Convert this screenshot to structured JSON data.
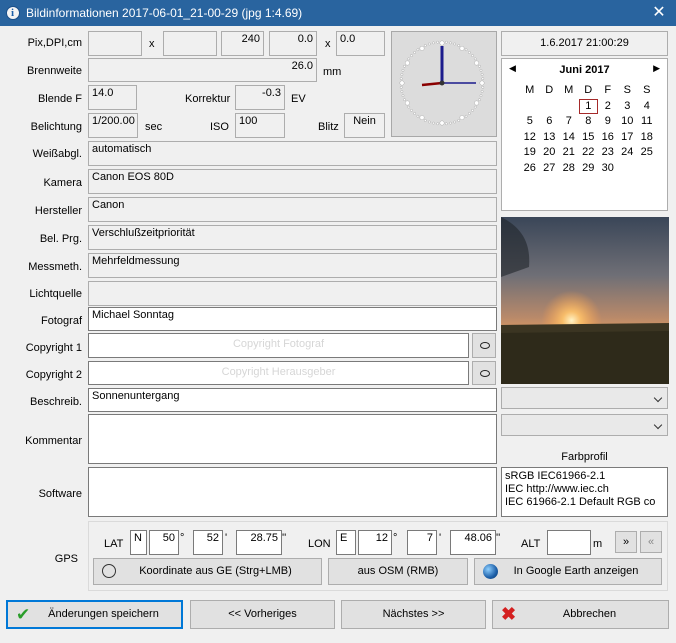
{
  "window": {
    "title": "Bildinformationen   2017-06-01_21-00-29   (jpg 1:4.69)",
    "close": "✕"
  },
  "pix": {
    "label": "Pix,DPI,cm",
    "sep": "x",
    "w": "",
    "h": "",
    "dpi": "240",
    "cm_w": "0.0",
    "cm_sep": "x",
    "cm_h": "0.0"
  },
  "brennweite": {
    "label": "Brennweite",
    "value": "26.0",
    "unit": "mm"
  },
  "blende": {
    "label": "Blende  F",
    "value": "14.0"
  },
  "korrektur": {
    "label": "Korrektur",
    "value": "-0.3",
    "unit": "EV"
  },
  "belichtung": {
    "label": "Belichtung",
    "value": "1/200.00",
    "unit": "sec"
  },
  "iso": {
    "label": "ISO",
    "value": "100"
  },
  "blitz": {
    "label": "Blitz",
    "value": "Nein"
  },
  "rows": {
    "weiss": {
      "label": "Weißabgl.",
      "value": "automatisch"
    },
    "kamera": {
      "label": "Kamera",
      "value": "Canon EOS 80D"
    },
    "hersteller": {
      "label": "Hersteller",
      "value": "Canon"
    },
    "belprg": {
      "label": "Bel. Prg.",
      "value": "Verschlußzeitpriorität"
    },
    "messmeth": {
      "label": "Messmeth.",
      "value": "Mehrfeldmessung"
    },
    "lichtquelle": {
      "label": "Lichtquelle",
      "value": ""
    },
    "fotograf": {
      "label": "Fotograf",
      "value": "Michael Sonntag"
    },
    "beschreib": {
      "label": "Beschreib.",
      "value": "Sonnenuntergang"
    },
    "kommentar": {
      "label": "Kommentar",
      "value": ""
    },
    "software": {
      "label": "Software",
      "value": ""
    }
  },
  "copyright1": {
    "label": "Copyright 1",
    "placeholder": "Copyright Fotograf"
  },
  "copyright2": {
    "label": "Copyright 2",
    "placeholder": "Copyright Herausgeber"
  },
  "datetime": "1.6.2017 21:00:29",
  "calendar": {
    "month": "Juni 2017",
    "prev": "◀",
    "next": "▶",
    "days": [
      "M",
      "D",
      "M",
      "D",
      "F",
      "S",
      "S"
    ],
    "cells": [
      "",
      "",
      "",
      "1",
      "2",
      "3",
      "4",
      "5",
      "6",
      "7",
      "8",
      "9",
      "10",
      "11",
      "12",
      "13",
      "14",
      "15",
      "16",
      "17",
      "18",
      "19",
      "20",
      "21",
      "22",
      "23",
      "24",
      "25",
      "26",
      "27",
      "28",
      "29",
      "30",
      "",
      ""
    ],
    "selected": "1"
  },
  "farbprofil": {
    "label": "Farbprofil",
    "lines": [
      "sRGB IEC61966-2.1",
      "IEC http://www.iec.ch",
      "IEC 61966-2.1 Default RGB co"
    ]
  },
  "gps": {
    "label": "GPS",
    "lat_label": "LAT",
    "lat_ref": "N",
    "lat_deg": "50",
    "lat_min": "52",
    "lat_sec": "28.75",
    "lon_label": "LON",
    "lon_ref": "E",
    "lon_deg": "12",
    "lon_min": "7",
    "lon_sec": "48.06",
    "alt_label": "ALT",
    "alt": "",
    "alt_unit": "m",
    "deg": "°",
    "min": "'",
    "sec": "''",
    "nav_next": "»",
    "nav_prev": "«"
  },
  "gps_buttons": {
    "ge": "Koordinate aus GE (Strg+LMB)",
    "osm": "aus OSM (RMB)",
    "earth": "In Google Earth anzeigen"
  },
  "bottom": {
    "save": "Änderungen speichern",
    "prev": "<< Vorheriges",
    "next": "Nächstes >>",
    "cancel": "Abbrechen"
  },
  "colors": {
    "titlebar": "#29649f",
    "accent": "#0078d7",
    "selected_day": "#a52a2a"
  }
}
